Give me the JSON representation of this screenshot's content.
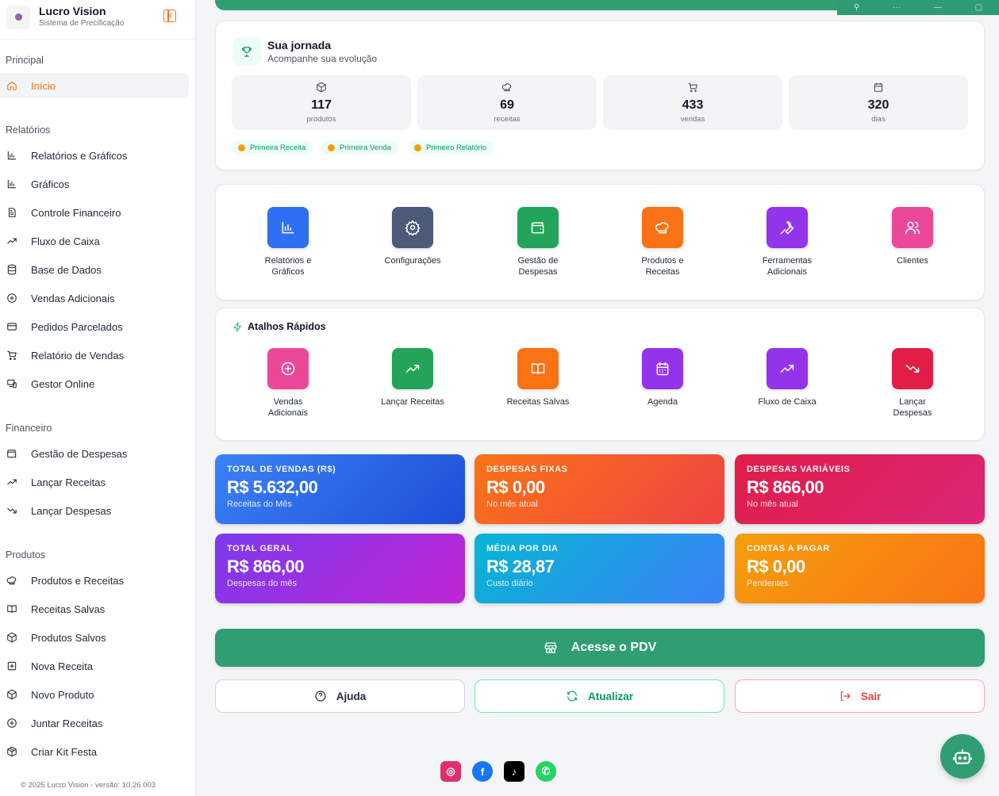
{
  "app": {
    "title": "Lucro Vision",
    "subtitle": "Sistema de Precificação",
    "version": "© 2025 Lucro Vision - versão: 10.26.003"
  },
  "sidebar": {
    "sections": {
      "principal": "Principal",
      "relatorios": "Relatórios",
      "financeiro": "Financeiro",
      "produtos": "Produtos"
    },
    "items": [
      {
        "label": "Início",
        "icon": "home-icon",
        "active": true
      },
      {
        "label": "Relatórios e Gráficos",
        "icon": "bar-chart-icon"
      },
      {
        "label": "Gráficos",
        "icon": "bar-chart-icon"
      },
      {
        "label": "Controle Financeiro",
        "icon": "document-icon"
      },
      {
        "label": "Fluxo de Caixa",
        "icon": "trending-up-icon"
      },
      {
        "label": "Base de Dados",
        "icon": "database-icon"
      },
      {
        "label": "Vendas Adicionais",
        "icon": "plus-circle-icon"
      },
      {
        "label": "Pedidos Parcelados",
        "icon": "credit-card-icon"
      },
      {
        "label": "Relatório de Vendas",
        "icon": "cart-icon"
      },
      {
        "label": "Gestor Online",
        "icon": "devices-icon"
      },
      {
        "label": "Gestão de Despesas",
        "icon": "wallet-icon"
      },
      {
        "label": "Lançar Receitas",
        "icon": "trending-up-icon"
      },
      {
        "label": "Lançar Despesas",
        "icon": "trending-down-icon"
      },
      {
        "label": "Produtos e Receitas",
        "icon": "chef-hat-icon"
      },
      {
        "label": "Receitas Salvas",
        "icon": "book-icon"
      },
      {
        "label": "Produtos Salvos",
        "icon": "package-icon"
      },
      {
        "label": "Nova Receita",
        "icon": "plus-square-icon"
      },
      {
        "label": "Novo Produto",
        "icon": "package-icon"
      },
      {
        "label": "Juntar Receitas",
        "icon": "plus-circle-icon"
      },
      {
        "label": "Criar Kit Festa",
        "icon": "gift-box-icon"
      }
    ]
  },
  "journey": {
    "title": "Sua jornada",
    "subtitle": "Acompanhe sua evolução",
    "stats": [
      {
        "value": "117",
        "label": "produtos",
        "icon": "package-icon"
      },
      {
        "value": "69",
        "label": "receitas",
        "icon": "chef-hat-icon"
      },
      {
        "value": "433",
        "label": "vendas",
        "icon": "cart-icon"
      },
      {
        "value": "320",
        "label": "dias",
        "icon": "calendar-icon"
      }
    ],
    "badges": [
      "Primeira Receita",
      "Primeira Venda",
      "Primeiro Relatório"
    ]
  },
  "modules": [
    {
      "label": "Relatórios e Gráficos",
      "color": "#2f6ff3",
      "icon": "bar-chart-icon"
    },
    {
      "label": "Configurações",
      "color": "#4b5b78",
      "icon": "gear-icon"
    },
    {
      "label": "Gestão de Despesas",
      "color": "#22a55a",
      "icon": "wallet-icon"
    },
    {
      "label": "Produtos e Receitas",
      "color": "#f97316",
      "icon": "chef-hat-icon"
    },
    {
      "label": "Ferramentas Adicionais",
      "color": "#9333ea",
      "icon": "wrench-icon"
    },
    {
      "label": "Clientes",
      "color": "#ec4899",
      "icon": "users-icon"
    }
  ],
  "shortcuts": {
    "title": "Atalhos Rápidos",
    "items": [
      {
        "label": "Vendas Adicionais",
        "color": "#ec4899",
        "icon": "plus-circle-icon"
      },
      {
        "label": "Lançar Receitas",
        "color": "#22a55a",
        "icon": "trending-up-icon"
      },
      {
        "label": "Receitas Salvas",
        "color": "#f97316",
        "icon": "book-icon"
      },
      {
        "label": "Agenda",
        "color": "#9333ea",
        "icon": "calendar-icon"
      },
      {
        "label": "Fluxo de Caixa",
        "color": "#9333ea",
        "icon": "trending-up-icon"
      },
      {
        "label": "Lançar Despesas",
        "color": "#e11d48",
        "icon": "trending-down-icon"
      }
    ]
  },
  "kpis": [
    {
      "title": "TOTAL DE VENDAS (R$)",
      "value": "R$ 5.632,00",
      "sub": "Receitas do Mês",
      "from": "#3b82f6",
      "to": "#1d4ed8"
    },
    {
      "title": "DESPESAS FIXAS",
      "value": "R$ 0,00",
      "sub": "No mês atual",
      "from": "#f97316",
      "to": "#ef4444"
    },
    {
      "title": "DESPESAS VARIÁVEIS",
      "value": "R$ 866,00",
      "sub": "No mês atual",
      "from": "#e11d48",
      "to": "#db2777"
    },
    {
      "title": "TOTAL GERAL",
      "value": "R$ 866,00",
      "sub": "Despesas do mês",
      "from": "#7c3aed",
      "to": "#c026d3"
    },
    {
      "title": "MÉDIA POR DIA",
      "value": "R$ 28,87",
      "sub": "Custo diário",
      "from": "#06b6d4",
      "to": "#3b82f6"
    },
    {
      "title": "CONTAS A PAGAR",
      "value": "R$ 0,00",
      "sub": "Pendentes",
      "from": "#f59e0b",
      "to": "#f97316"
    }
  ],
  "actions": {
    "pdv": "Acesse o PDV",
    "help": "Ajuda",
    "refresh": "Atualizar",
    "logout": "Sair"
  },
  "social": [
    {
      "name": "instagram-icon",
      "color": "#e1306c"
    },
    {
      "name": "facebook-icon",
      "color": "#1877f2"
    },
    {
      "name": "tiktok-icon",
      "color": "#000000"
    },
    {
      "name": "whatsapp-icon",
      "color": "#25d366"
    }
  ]
}
